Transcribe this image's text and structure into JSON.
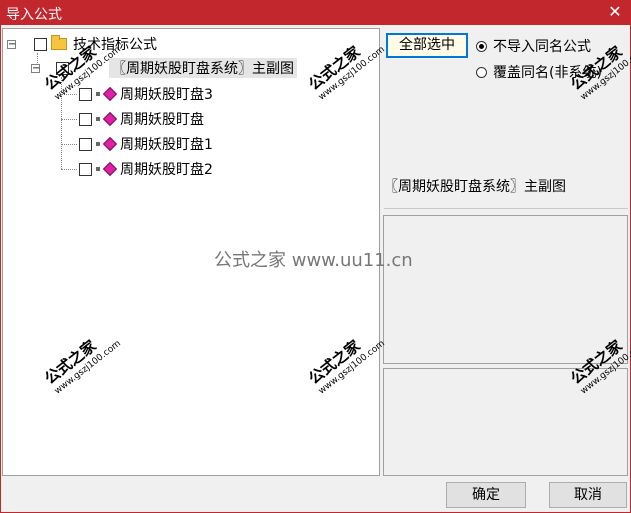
{
  "window": {
    "title": "导入公式",
    "close_glyph": "✕"
  },
  "tree": {
    "root": {
      "label": "技术指标公式",
      "expander": "−"
    },
    "system": {
      "label": "〖周期妖股盯盘系统〗主副图",
      "expander": "−"
    },
    "formulas": [
      {
        "label": "周期妖股盯盘3"
      },
      {
        "label": "周期妖股盯盘"
      },
      {
        "label": "周期妖股盯盘1"
      },
      {
        "label": "周期妖股盯盘2"
      }
    ]
  },
  "right": {
    "select_all_label": "全部选中",
    "radio_options": [
      {
        "label": "不导入同名公式",
        "checked": true
      },
      {
        "label": "覆盖同名(非系统)",
        "checked": false
      }
    ],
    "selected_name": "〖周期妖股盯盘系统〗主副图"
  },
  "buttons": {
    "ok": "确定",
    "cancel": "取消"
  },
  "watermark": {
    "site": "公式之家",
    "url": "www.gszj100.com",
    "center": "公式之家 www.uu11.cn"
  }
}
